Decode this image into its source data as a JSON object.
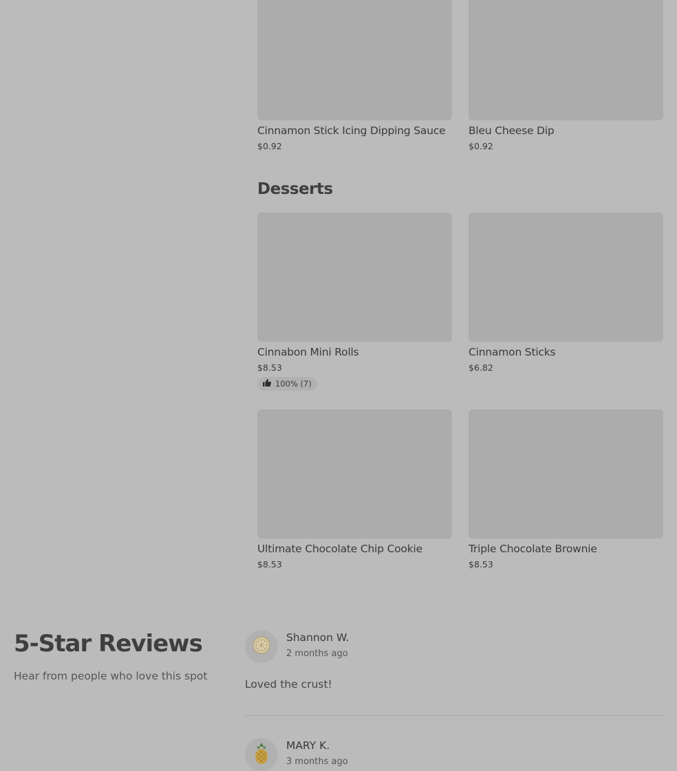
{
  "top_items": [
    {
      "name": "Cinnamon Stick Icing Dipping Sauce",
      "price": "$0.92"
    },
    {
      "name": "Bleu Cheese Dip",
      "price": "$0.92"
    }
  ],
  "desserts": {
    "title": "Desserts",
    "items": [
      {
        "name": "Cinnabon Mini Rolls",
        "price": "$8.53",
        "rating": "100% (7)",
        "rating_fraction": 1.0
      },
      {
        "name": "Cinnamon Sticks",
        "price": "$6.82"
      },
      {
        "name": "Ultimate Chocolate Chip Cookie",
        "price": "$8.53"
      },
      {
        "name": "Triple Chocolate Brownie",
        "price": "$8.53"
      }
    ]
  },
  "reviews": {
    "title": "5-Star Reviews",
    "subtitle": "Hear from people who love this spot",
    "items": [
      {
        "author": "Shannon W.",
        "time": "2 months ago",
        "text": "Loved the crust!",
        "avatar_icon": "lemon-icon"
      },
      {
        "author": "MARY K.",
        "time": "3 months ago",
        "text": "",
        "avatar_icon": "pineapple-icon"
      }
    ]
  },
  "colors": {
    "background": "#bbbbbb",
    "placeholder_image": "#acacac",
    "text": "#3f3f3f"
  }
}
